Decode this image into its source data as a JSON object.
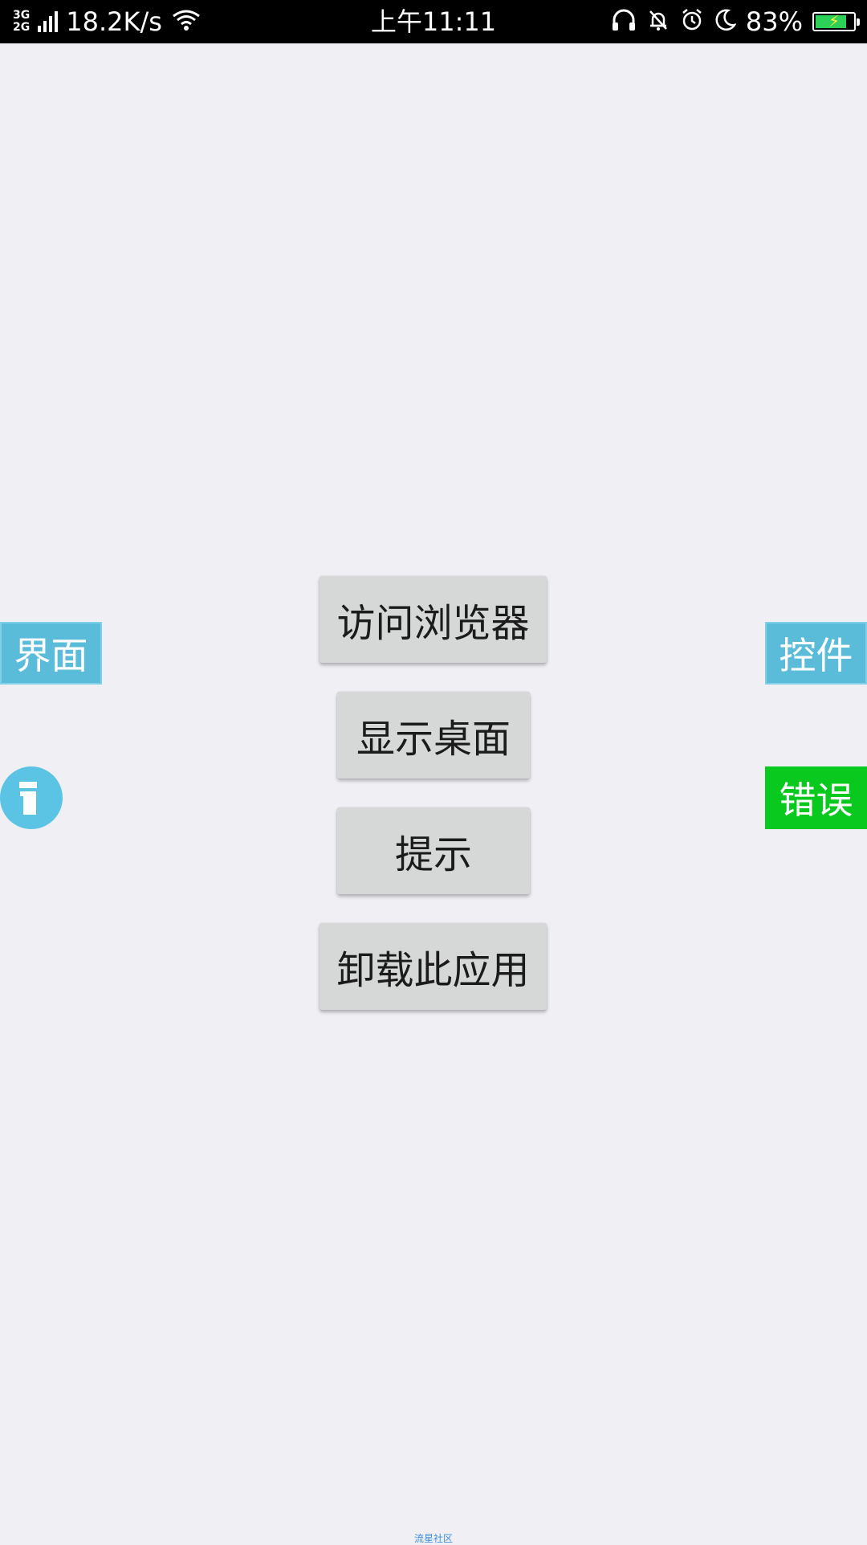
{
  "status_bar": {
    "network_type_top": "3G",
    "network_type_bottom": "2G",
    "speed": "18.2K/s",
    "time": "上午11:11",
    "battery_percent": "83%",
    "battery_level": 0.83,
    "icons": [
      "signal-icon",
      "wifi-icon",
      "headphones-icon",
      "bell-muted-icon",
      "alarm-icon",
      "moon-icon",
      "battery-icon"
    ],
    "battery_fill_color": "#2ed158"
  },
  "buttons": {
    "visit_browser": "访问浏览器",
    "show_desktop": "显示桌面",
    "hint": "提示",
    "uninstall": "卸载此应用"
  },
  "side_tabs": {
    "interface": "界面",
    "controls": "控件",
    "error": "错误"
  },
  "colors": {
    "tab_blue": "#5bbcd9",
    "tab_green": "#09c91e",
    "info_circle": "#5bc3e4",
    "background": "#efeff4"
  },
  "footer": {
    "link": "流星社区"
  }
}
